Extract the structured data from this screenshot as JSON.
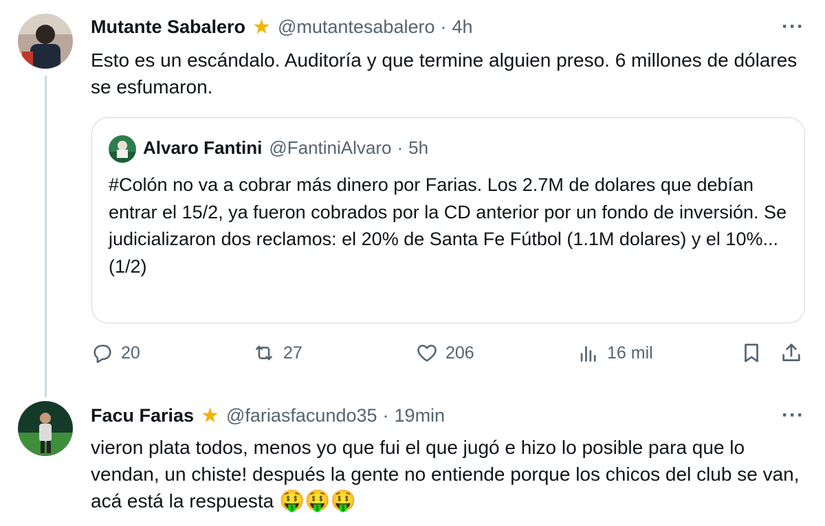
{
  "tweets": [
    {
      "name": "Mutante Sabalero",
      "handle": "@mutantesabalero",
      "separator": "·",
      "time": "4h",
      "text": "Esto es un escándalo. Auditoría y que termine alguien preso. 6 millones de dólares se esfumaron.",
      "quote": {
        "name": "Alvaro Fantini",
        "handle": "@FantiniAlvaro",
        "separator": "·",
        "time": "5h",
        "text": "#Colón no va a cobrar más dinero por Farias. Los 2.7M de dolares que debían entrar el 15/2, ya fueron cobrados por la CD anterior por un fondo de inversión. Se judicializaron dos reclamos: el 20% de Santa Fe Fútbol (1.1M dolares) y el 10%...",
        "continuation": "(1/2)"
      },
      "stats": {
        "replies": "20",
        "reposts": "27",
        "likes": "206",
        "views": "16 mil"
      }
    },
    {
      "name": "Facu Farias",
      "handle": "@fariasfacundo35",
      "separator": "·",
      "time": "19min",
      "text": "vieron plata todos, menos yo que fui el que jugó e hizo lo posible para que lo vendan, un chiste! después la gente no entiende porque los chicos del club se van, acá está la respuesta",
      "emojis": "🤑🤑🤑"
    }
  ],
  "icons": {
    "verified": "star-badge-icon",
    "more": "more-options-icon",
    "reply": "reply-icon",
    "repost": "repost-icon",
    "like": "heart-icon",
    "views": "views-chart-icon",
    "bookmark": "bookmark-icon",
    "share": "share-icon"
  },
  "colors": {
    "text": "#0f1419",
    "secondary": "#536471",
    "border": "#cfd9de",
    "badge": "#f5b300"
  }
}
